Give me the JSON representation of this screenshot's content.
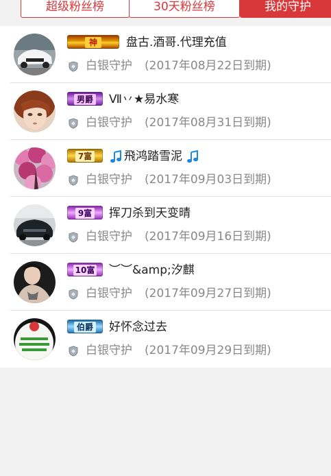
{
  "tabs": [
    {
      "label": "超级粉丝榜",
      "active": false
    },
    {
      "label": "30天粉丝榜",
      "active": false
    },
    {
      "label": "我的守护",
      "active": true
    }
  ],
  "accent_color": "#d8383a",
  "guards": [
    {
      "badge": "神",
      "badge_style": "shen",
      "name": "盘古.酒哥.代理充值",
      "guard_level": "白银守护",
      "expiry": "(2017年08月22日到期)",
      "avatar": "white-car-avatar"
    },
    {
      "badge": "男爵",
      "badge_style": "nanjue",
      "name": "Ⅶ丷★易水寒",
      "guard_level": "白银守护",
      "expiry": "(2017年08月31日到期)",
      "avatar": "doll-face-avatar"
    },
    {
      "badge": "7富",
      "badge_style": "fu7",
      "name": "飛鸿踏雪泥",
      "name_note_icons": true,
      "guard_level": "白银守护",
      "expiry": "(2017年09月03日到期)",
      "avatar": "blossom-tree-avatar"
    },
    {
      "badge": "9富",
      "badge_style": "fu9",
      "name": "挥刀杀到天变晴",
      "guard_level": "白银守护",
      "expiry": "(2017年09月16日到期)",
      "avatar": "dark-car-avatar"
    },
    {
      "badge": "10富",
      "badge_style": "fu10",
      "name": "︶︶&amp;汐麒",
      "guard_level": "白银守护",
      "expiry": "(2017年09月27日到期)",
      "avatar": "man-portrait-avatar"
    },
    {
      "badge": "伯爵",
      "badge_style": "bojue",
      "name": "好怀念过去",
      "guard_level": "白银守护",
      "expiry": "(2017年09月29日到期)",
      "avatar": "shirt-text-avatar"
    }
  ]
}
